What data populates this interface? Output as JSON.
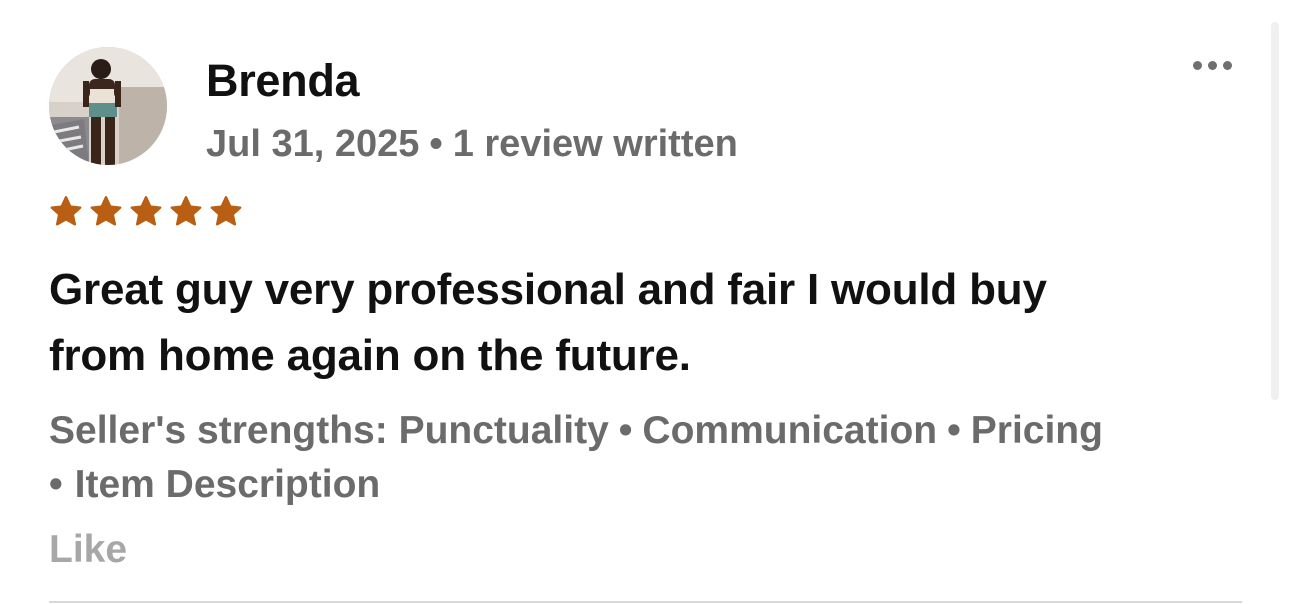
{
  "review": {
    "reviewer_name": "Brenda",
    "date": "Jul 31, 2025",
    "meta_separator": "•",
    "review_count": "1 review written",
    "rating": 5,
    "rating_max": 5,
    "star_color": "#b85f14",
    "text_line1": "Great guy very professional and fair I would buy",
    "text_line2": "from home again on the future.",
    "strengths_label": "Seller's strengths:",
    "strengths": [
      "Punctuality",
      "Communication",
      "Pricing",
      "Item Description"
    ],
    "separator": "•",
    "like_label": "Like",
    "more_icon": "more-options-icon"
  }
}
